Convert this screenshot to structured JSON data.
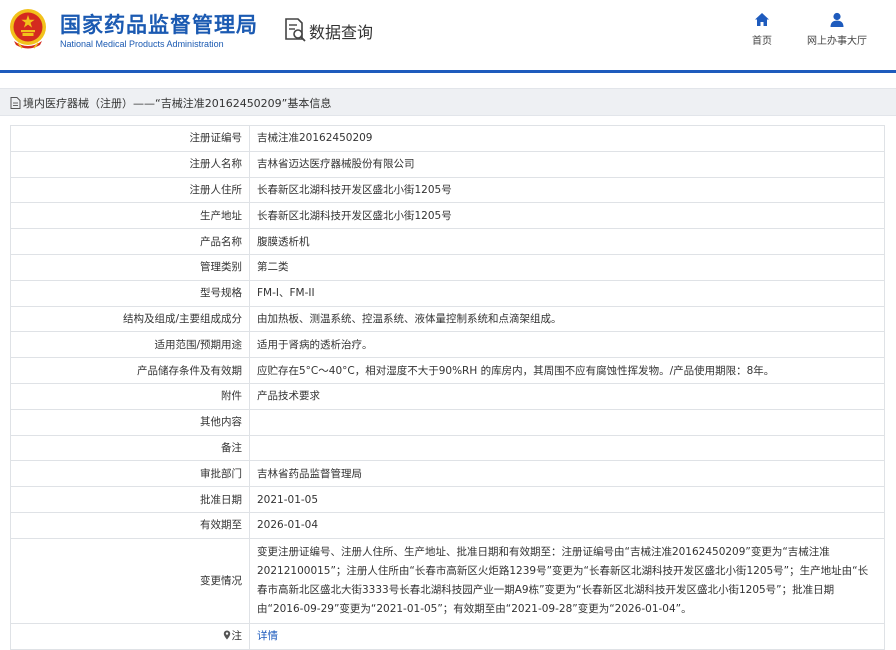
{
  "header": {
    "brand_cn": "国家药品监督管理局",
    "brand_en": "National Medical Products Administration",
    "section_title": "数据查询",
    "nav": [
      {
        "label": "首页",
        "icon": "home-icon"
      },
      {
        "label": "网上办事大厅",
        "icon": "user-icon"
      }
    ]
  },
  "breadcrumb": {
    "text": "境内医疗器械（注册）——“吉械注准20162450209”基本信息",
    "icon": "document-icon"
  },
  "colors": {
    "brand_blue": "#1b5ab2",
    "separator": "#1e5bbd",
    "emblem_red": "#d42a1f",
    "emblem_gold": "#f2c21b"
  },
  "rows": [
    {
      "label": "注册证编号",
      "value": "吉械注准20162450209"
    },
    {
      "label": "注册人名称",
      "value": "吉林省迈达医疗器械股份有限公司"
    },
    {
      "label": "注册人住所",
      "value": "长春新区北湖科技开发区盛北小街1205号"
    },
    {
      "label": "生产地址",
      "value": "长春新区北湖科技开发区盛北小街1205号"
    },
    {
      "label": "产品名称",
      "value": "腹膜透析机"
    },
    {
      "label": "管理类别",
      "value": "第二类"
    },
    {
      "label": "型号规格",
      "value": "FM-I、FM-II"
    },
    {
      "label": "结构及组成/主要组成成分",
      "value": "由加热板、测温系统、控温系统、液体量控制系统和点滴架组成。"
    },
    {
      "label": "适用范围/预期用途",
      "value": "适用于肾病的透析治疗。"
    },
    {
      "label": "产品储存条件及有效期",
      "value": "应贮存在5°C～40°C，相对湿度不大于90%RH 的库房内，其周围不应有腐蚀性挥发物。/产品使用期限：8年。"
    },
    {
      "label": "附件",
      "value": "产品技术要求"
    },
    {
      "label": "其他内容",
      "value": ""
    },
    {
      "label": "备注",
      "value": ""
    },
    {
      "label": "审批部门",
      "value": "吉林省药品监督管理局"
    },
    {
      "label": "批准日期",
      "value": "2021-01-05"
    },
    {
      "label": "有效期至",
      "value": "2026-01-04"
    },
    {
      "label": "变更情况",
      "value": "变更注册证编号、注册人住所、生产地址、批准日期和有效期至：注册证编号由“吉械注准20162450209”变更为“吉械注准20212100015”；注册人住所由“长春市高新区火炬路1239号”变更为“长春新区北湖科技开发区盛北小街1205号”；生产地址由“长春市高新北区盛北大街3333号长春北湖科技园产业一期A9栋”变更为“长春新区北湖科技开发区盛北小街1205号”；批准日期由“2016-09-29”变更为“2021-01-05”；有效期至由“2021-09-28”变更为“2026-01-04”。"
    }
  ],
  "note": {
    "label": "注",
    "link": "详情",
    "icon": "pin-icon"
  }
}
